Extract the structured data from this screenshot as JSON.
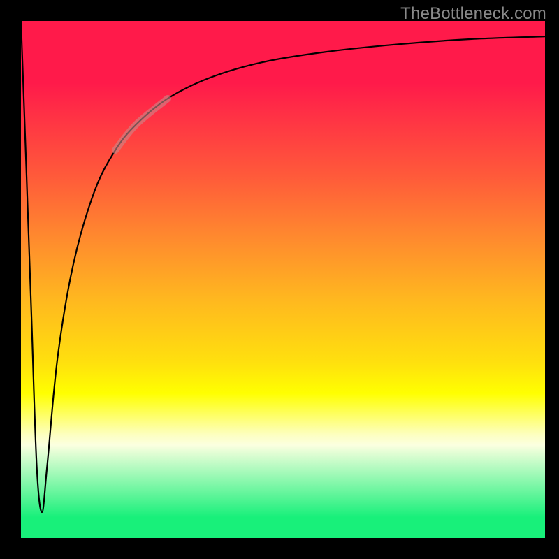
{
  "watermark": "TheBottleneck.com",
  "chart_data": {
    "type": "line",
    "title": "",
    "xlabel": "",
    "ylabel": "",
    "xlim": [
      0,
      100
    ],
    "ylim": [
      0,
      100
    ],
    "grid": false,
    "series": [
      {
        "name": "curve",
        "x": [
          0,
          1,
          2,
          3,
          4,
          5,
          7,
          10,
          14,
          18,
          22,
          28,
          36,
          46,
          58,
          72,
          86,
          100
        ],
        "values": [
          100,
          72,
          43,
          14,
          5,
          14,
          35,
          53,
          67,
          75,
          80,
          85,
          89,
          92,
          94,
          95.5,
          96.5,
          97
        ]
      }
    ],
    "highlight_segment": {
      "series": "curve",
      "x_from": 18,
      "x_to": 28,
      "color": "#c98a8a"
    },
    "background_gradient": {
      "direction": "vertical",
      "stops": [
        {
          "pos": 0.0,
          "color": "#ff1a4a"
        },
        {
          "pos": 0.72,
          "color": "#ffff00"
        },
        {
          "pos": 0.96,
          "color": "#18f07a"
        },
        {
          "pos": 1.0,
          "color": "#18f07a"
        }
      ]
    }
  }
}
